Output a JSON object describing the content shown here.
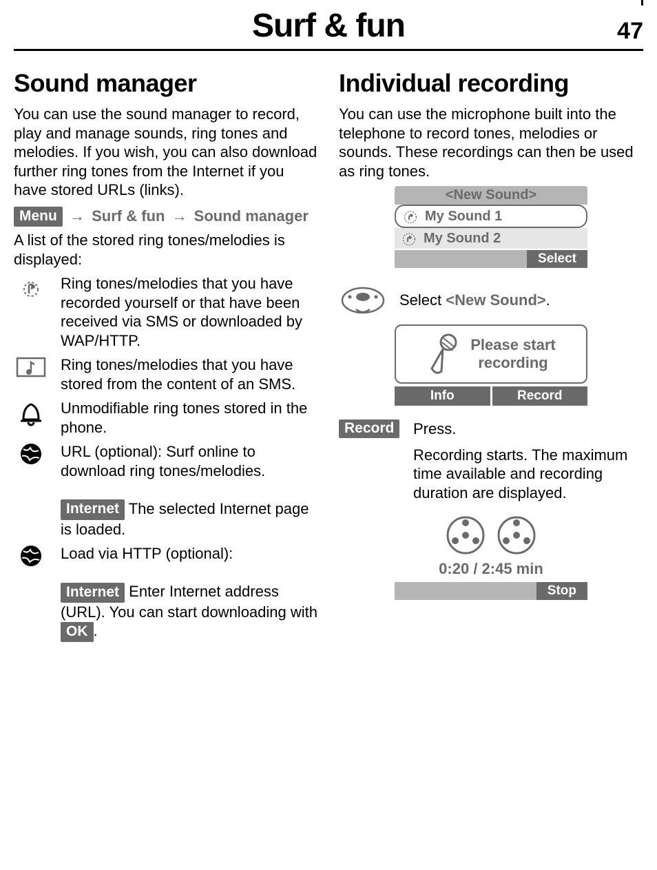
{
  "header": {
    "title": "Surf & fun",
    "page_number": "47"
  },
  "left": {
    "h2": "Sound manager",
    "intro": "You can use the sound manager to record, play and manage sounds, ring tones and melodies. If you wish, you can also download further ring tones from the Internet if you have stored URLs (links).",
    "path": {
      "menu_badge": "Menu",
      "seg1": "Surf & fun",
      "seg2": "Sound manager"
    },
    "after_path": "A list of the stored ring tones/melodies is displayed:",
    "items": [
      {
        "icon": "record-icon",
        "text": "Ring tones/melodies that you have recorded yourself or that have been received via SMS or downloaded by WAP/HTTP."
      },
      {
        "icon": "note-box-icon",
        "text": "Ring tones/melodies that you have stored from the content of an SMS."
      },
      {
        "icon": "bell-icon",
        "text": "Unmodifiable ring tones stored in the phone."
      },
      {
        "icon": "globe-icon",
        "text_pre": "URL (optional): Surf online to download ring tones/melodies.",
        "internet_badge": "Internet",
        "text_post": "The selected Internet page is loaded."
      },
      {
        "icon": "globe-icon",
        "text_pre": "Load via HTTP (optional):",
        "internet_badge": "Internet",
        "text_mid": "Enter Internet address (URL). You can start downloading with",
        "ok_badge": "OK",
        "text_post2": "."
      }
    ]
  },
  "right": {
    "h2": "Individual recording",
    "intro": "You can use the microphone built into the telephone to record tones, melodies or sounds. These recordings can then be used as ring tones.",
    "phone_list": {
      "header": "<New Sound>",
      "items": [
        "My Sound 1",
        "My Sound 2"
      ],
      "soft_right": "Select"
    },
    "nav_instruction_pre": "Select ",
    "nav_instruction_bold": "<New Sound>",
    "nav_instruction_post": ".",
    "prompt": {
      "line1": "Please start",
      "line2": "recording",
      "soft_left": "Info",
      "soft_right": "Record"
    },
    "record_def": {
      "label_badge": "Record",
      "line1": "Press.",
      "line2": "Recording starts. The maximum time available and recording duration are displayed."
    },
    "rec_screen": {
      "time": "0:20 / 2:45 min",
      "soft_right": "Stop"
    }
  }
}
